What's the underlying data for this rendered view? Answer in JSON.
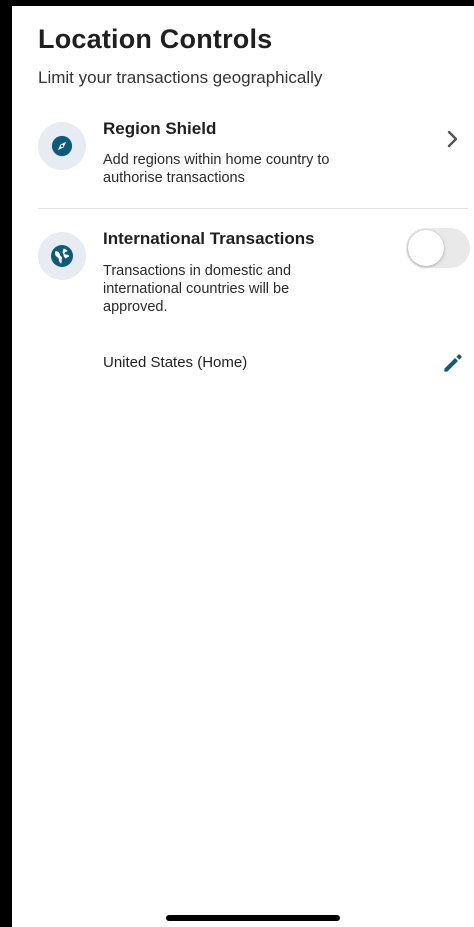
{
  "header": {
    "title": "Location Controls",
    "subtitle": "Limit your transactions geographically"
  },
  "region_shield": {
    "title": "Region Shield",
    "description": "Add regions within home country to authorise transactions",
    "icon": "compass-icon"
  },
  "international": {
    "title": "International Transactions",
    "description": "Transactions in domestic and international countries will be approved.",
    "icon": "globe-icon",
    "toggle_on": false
  },
  "home_country": {
    "label": "United States (Home)",
    "edit_icon": "pencil-icon"
  },
  "colors": {
    "accent": "#0f5a7a",
    "icon_bg": "#e6ecf1",
    "toggle_off": "#e9e9ea"
  }
}
